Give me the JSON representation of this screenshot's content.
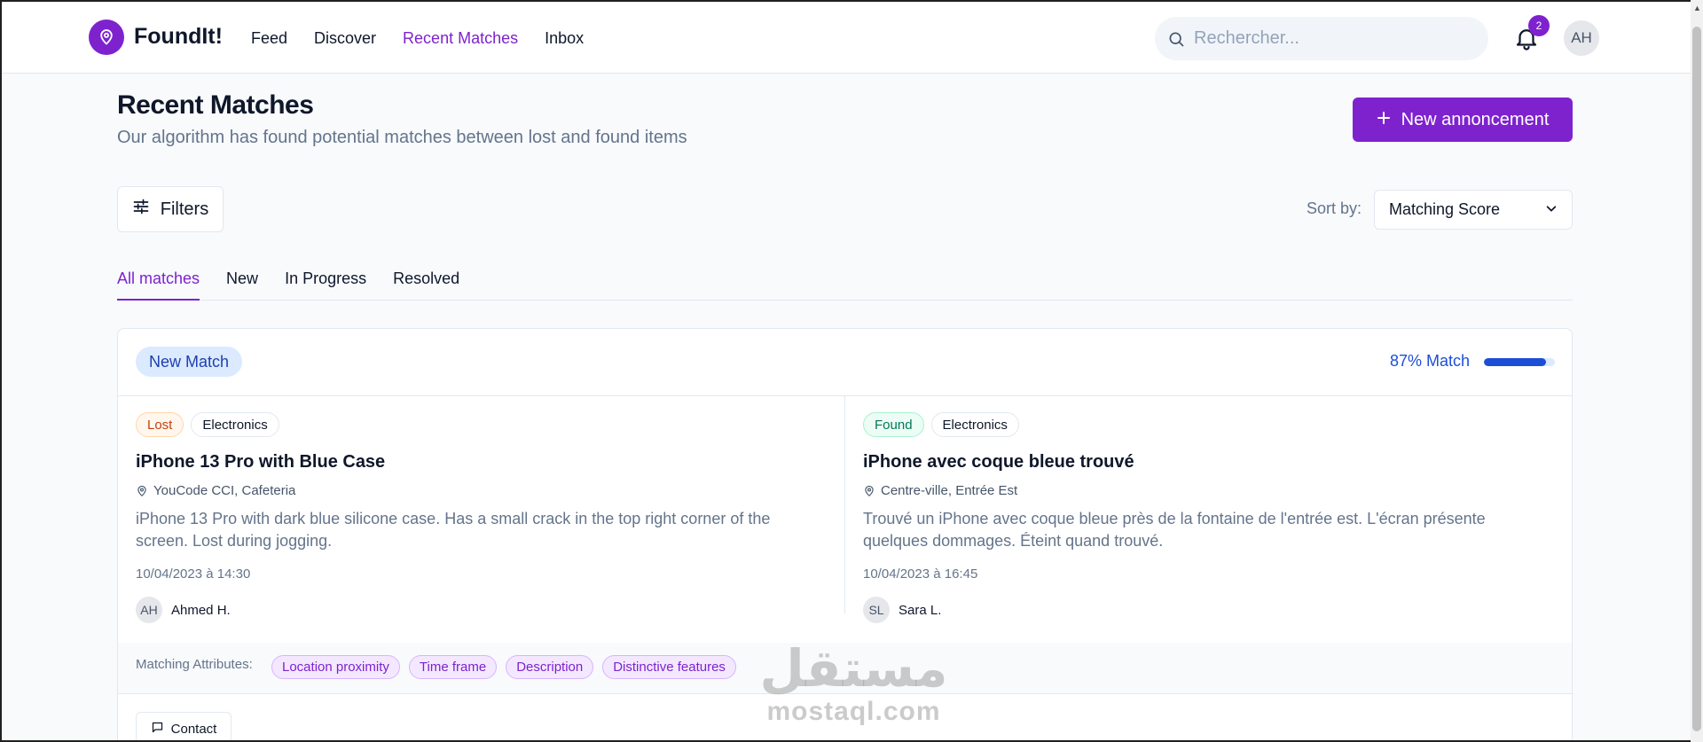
{
  "header": {
    "app_name": "FoundIt!",
    "nav": [
      "Feed",
      "Discover",
      "Recent Matches",
      "Inbox"
    ],
    "active_nav": "Recent Matches",
    "search_placeholder": "Rechercher...",
    "notification_count": "2",
    "user_initials": "AH"
  },
  "page": {
    "title": "Recent Matches",
    "subtitle": "Our algorithm has found potential matches between lost and found items",
    "new_button_label": "New annoncement",
    "filters_label": "Filters",
    "sort_label": "Sort by:",
    "sort_value": "Matching Score",
    "tabs": [
      "All matches",
      "New",
      "In Progress",
      "Resolved"
    ],
    "active_tab": "All matches"
  },
  "match": {
    "badge": "New Match",
    "score_label": "87% Match",
    "score_fraction": 0.87,
    "lost_item": {
      "status": "Lost",
      "category": "Electronics",
      "title": "iPhone 13 Pro with Blue Case",
      "location": "YouCode CCI, Cafeteria",
      "description": "iPhone 13 Pro with dark blue silicone case. Has a small crack in the top right corner of the screen. Lost during jogging.",
      "date": "10/04/2023 à 14:30",
      "user_initials": "AH",
      "user_name": "Ahmed H."
    },
    "found_item": {
      "status": "Found",
      "category": "Electronics",
      "title": "iPhone avec coque bleue trouvé",
      "location": "Centre-ville, Entrée Est",
      "description": "Trouvé un iPhone avec coque bleue près de la fontaine de l'entrée est. L'écran présente quelques dommages. Éteint quand trouvé.",
      "date": "10/04/2023 à 16:45",
      "user_initials": "SL",
      "user_name": "Sara L."
    },
    "attributes_label": "Matching Attributes:",
    "attributes": [
      "Location proximity",
      "Time frame",
      "Description",
      "Distinctive features"
    ],
    "contact_label": "Contact"
  },
  "watermark": {
    "arabic": "مستقل",
    "latin": "mostaql.com"
  },
  "colors": {
    "brand": "#7e22ce",
    "match_blue": "#1d4ed8",
    "lost": "#c2410c",
    "found": "#047857"
  }
}
